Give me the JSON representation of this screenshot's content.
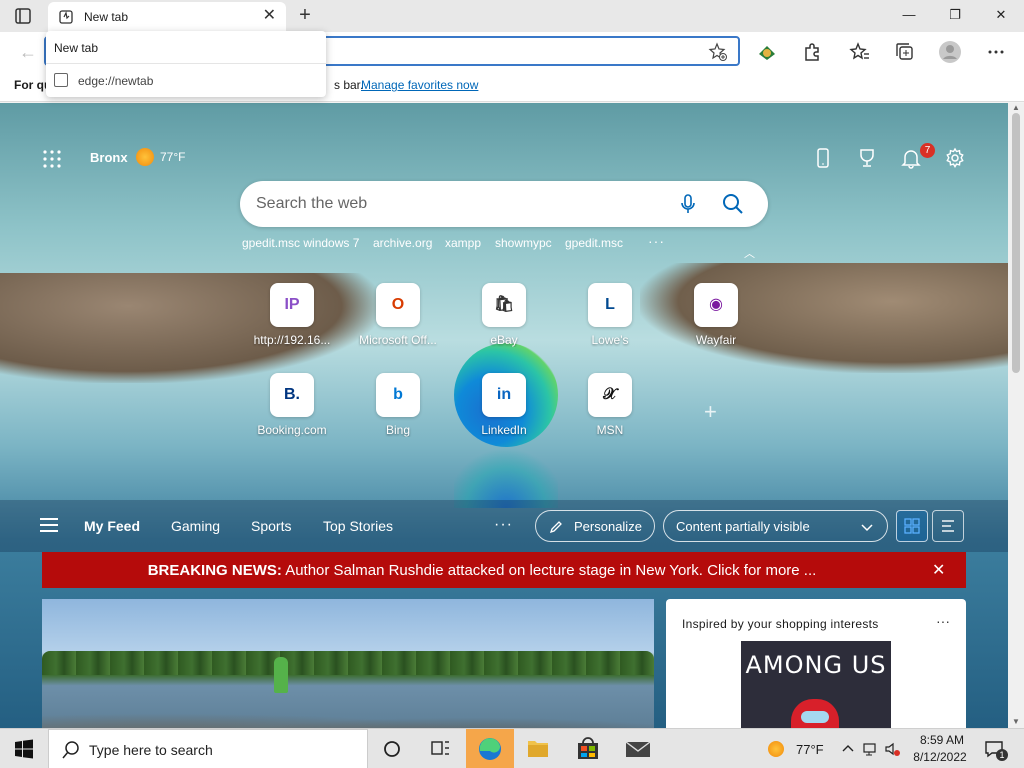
{
  "tab": {
    "title": "New tab",
    "close": "✕",
    "new": "+"
  },
  "window": {
    "minimize": "—",
    "maximize": "❐",
    "close": "✕"
  },
  "toolbar": {
    "back": "←"
  },
  "dropdown": {
    "item1": "New tab",
    "item2": "edge://newtab"
  },
  "favbar": {
    "prefix": "For qu",
    "suffix": "s bar.",
    "link": "Manage favorites now"
  },
  "weather": {
    "city": "Bronx",
    "temp": "77°F"
  },
  "notifications": {
    "count": "7"
  },
  "search": {
    "placeholder": "Search the web"
  },
  "quick_links": [
    "gpedit.msc windows 7",
    "archive.org",
    "xampp",
    "showmypc",
    "gpedit.msc"
  ],
  "quick_more": "···",
  "tiles": [
    {
      "label": "http://192.16...",
      "glyph": "IP",
      "color": "#8b4fc7"
    },
    {
      "label": "Microsoft Off...",
      "glyph": "O",
      "color": "#d83b01"
    },
    {
      "label": "eBay",
      "glyph": "🛍",
      "color": "#333333"
    },
    {
      "label": "Lowe's",
      "glyph": "L",
      "color": "#004990"
    },
    {
      "label": "Wayfair",
      "glyph": "◉",
      "color": "#7b189f"
    },
    {
      "label": "Booking.com",
      "glyph": "B.",
      "color": "#003580"
    },
    {
      "label": "Bing",
      "glyph": "b",
      "color": "#0078d4"
    },
    {
      "label": "LinkedIn",
      "glyph": "in",
      "color": "#0a66c2"
    },
    {
      "label": "MSN",
      "glyph": "𝒳",
      "color": "#111111"
    }
  ],
  "add_tile": "+",
  "feed": {
    "tabs": [
      "My Feed",
      "Gaming",
      "Sports",
      "Top Stories"
    ],
    "more": "···",
    "personalize": "Personalize",
    "content": "Content partially visible"
  },
  "breaking": {
    "label": "BREAKING NEWS:",
    "text": " Author Salman Rushdie attacked on lecture stage in New York. Click for more ...",
    "close": "✕"
  },
  "shopping": {
    "title": "Inspired by your shopping interests",
    "more": "···",
    "product_title": "AMONG US"
  },
  "taskbar": {
    "search": "Type here to search",
    "temp": "77°F",
    "time": "8:59 AM",
    "date": "8/12/2022",
    "notif_count": "1"
  },
  "colors": {
    "accent": "#0067b8",
    "breaking": "#b50b0b",
    "taskbar_active": "#f5a64a"
  }
}
